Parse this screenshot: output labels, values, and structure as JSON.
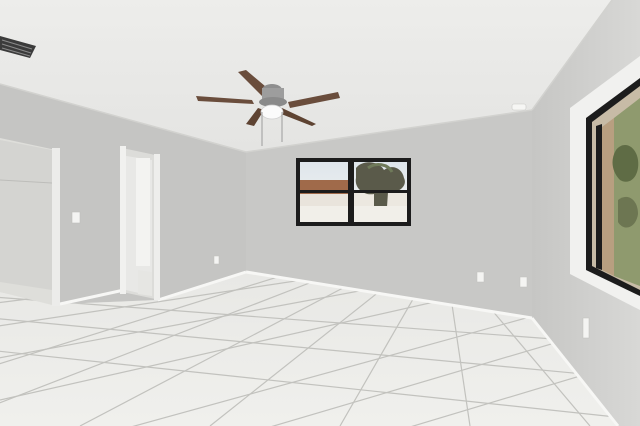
{
  "scene": {
    "kind": "photo",
    "subject": "empty room",
    "colors": {
      "ceiling": "#eeeeec",
      "wall_back": "#c9c9c7",
      "wall_left": "#c4c4c2",
      "wall_right": "#cfcfcd",
      "floor": "#e6e6e3",
      "grout": "#bdbdb9",
      "baseboard": "#f5f5f3",
      "window_frame": "#1f1f1f",
      "fan_blade": "#6a4d3c",
      "fan_hub": "#9a9a9a"
    },
    "objects": [
      "ceiling-fan",
      "back-window",
      "right-window",
      "hallway-doorway",
      "closet-opening",
      "hvac-vent",
      "light-switch",
      "outlets",
      "tile-floor"
    ]
  }
}
